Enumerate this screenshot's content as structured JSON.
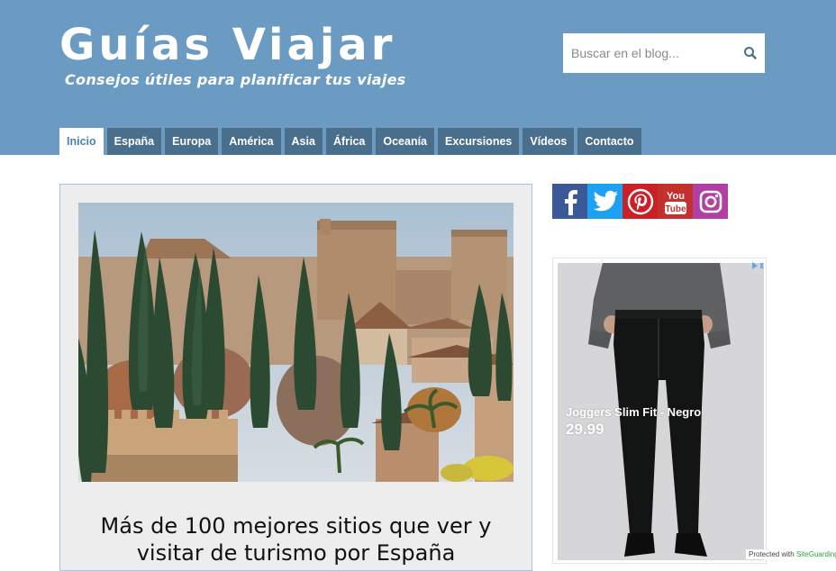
{
  "header": {
    "title": "Guías Viajar",
    "tagline": "Consejos útiles para planificar tus viajes",
    "background": "#6b9bc3"
  },
  "search": {
    "placeholder": "Buscar en el blog...",
    "value": "",
    "icon": "search-icon"
  },
  "nav": {
    "items": [
      {
        "label": "Inicio",
        "active": true
      },
      {
        "label": "España",
        "active": false
      },
      {
        "label": "Europa",
        "active": false
      },
      {
        "label": "América",
        "active": false
      },
      {
        "label": "Asia",
        "active": false
      },
      {
        "label": "África",
        "active": false
      },
      {
        "label": "Oceanía",
        "active": false
      },
      {
        "label": "Excursiones",
        "active": false
      },
      {
        "label": "Vídeos",
        "active": false
      },
      {
        "label": "Contacto",
        "active": false
      }
    ]
  },
  "post": {
    "image": "alhambra-photo",
    "title": "Más de 100 mejores sitios que ver y visitar de turismo por España"
  },
  "social": {
    "items": [
      {
        "icon": "facebook-icon",
        "color": "#3b5998"
      },
      {
        "icon": "twitter-icon",
        "color": "#1da1f2"
      },
      {
        "icon": "pinterest-icon",
        "color": "#cb2027"
      },
      {
        "icon": "youtube-icon",
        "color": "#c4302b"
      },
      {
        "icon": "instagram-icon",
        "color": "#b23fa3"
      }
    ]
  },
  "ad": {
    "product": "Joggers Slim Fit - Negro",
    "price": "29.99",
    "icon": "adchoices-icon"
  },
  "footer_badge": {
    "text": "Protected with",
    "brand": "SiteGuarding"
  }
}
